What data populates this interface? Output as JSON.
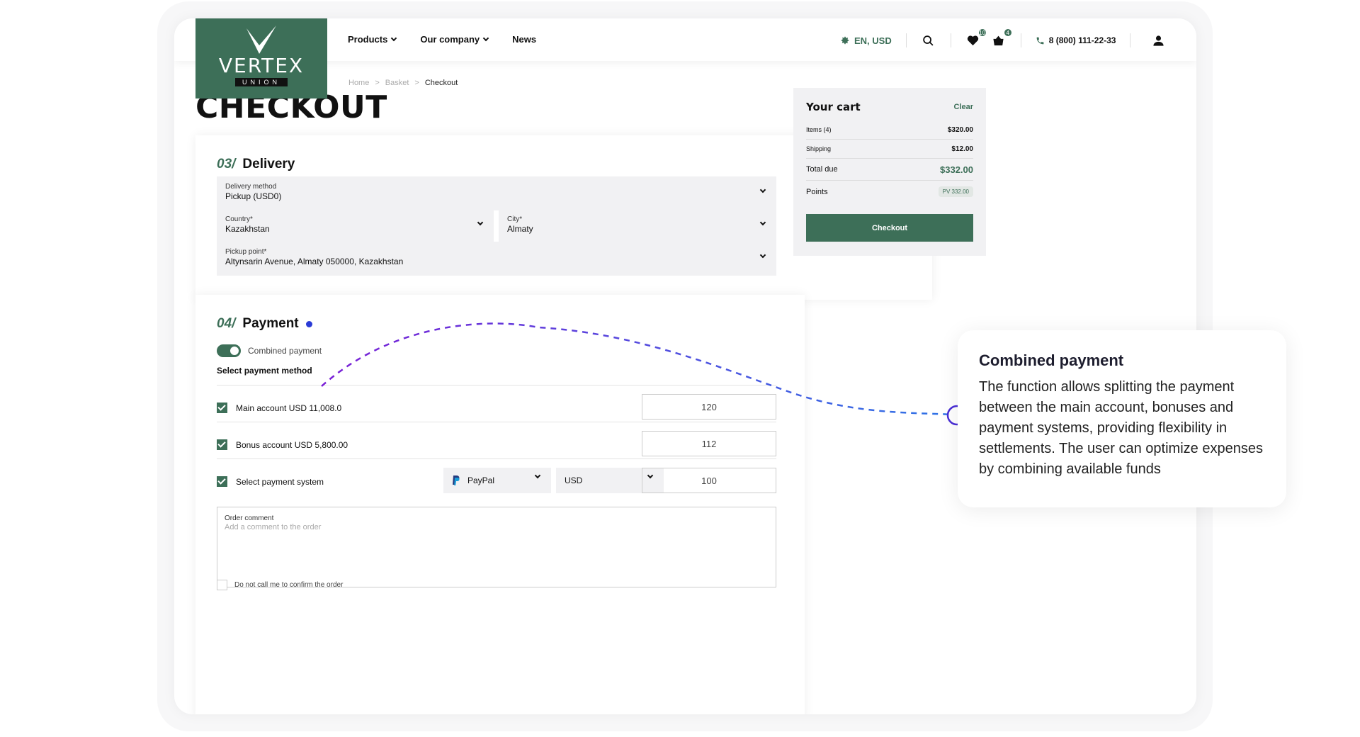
{
  "brand": {
    "logo_word": "VERTEX",
    "logo_sub": "UNION",
    "accent": "#3d6f58"
  },
  "nav": {
    "items": [
      {
        "label": "Products",
        "has_dropdown": true
      },
      {
        "label": "Our company",
        "has_dropdown": true
      },
      {
        "label": "News",
        "has_dropdown": false
      }
    ]
  },
  "header": {
    "locale": "EN, USD",
    "wishlist_count": "10",
    "cart_count": "4",
    "phone": "8 (800) 111-22-33"
  },
  "breadcrumb": {
    "items": [
      "Home",
      "Basket",
      "Checkout"
    ]
  },
  "page": {
    "title": "CHECKOUT"
  },
  "delivery": {
    "num": "03/",
    "title": "Delivery",
    "method": {
      "label": "Delivery method",
      "value": "Pickup (USD0)"
    },
    "country": {
      "label": "Country*",
      "value": "Kazakhstan"
    },
    "city": {
      "label": "City*",
      "value": "Almaty"
    },
    "pickup": {
      "label": "Pickup point*",
      "value": "Altynsarin Avenue, Almaty 050000, Kazakhstan"
    }
  },
  "payment": {
    "num": "04/",
    "title": "Payment",
    "combined_label": "Combined payment",
    "select_title": "Select payment method",
    "rows": [
      {
        "label": "Main account USD 11,008.0",
        "amount": "120"
      },
      {
        "label": "Bonus account USD 5,800.00",
        "amount": "112"
      },
      {
        "label": "Select payment system",
        "amount": "100",
        "system": "PayPal",
        "currency": "USD"
      }
    ],
    "comment": {
      "label": "Order comment",
      "placeholder": "Add a comment to the order"
    },
    "no_call": "Do not call me to confirm the order"
  },
  "cart": {
    "title": "Your cart",
    "clear": "Clear",
    "items_label": "Items (4)",
    "items_value": "$320.00",
    "shipping_label": "Shipping",
    "shipping_value": "$12.00",
    "total_label": "Total due",
    "total_value": "$332.00",
    "points_label": "Points",
    "points_value": "PV 332.00",
    "checkout": "Checkout"
  },
  "callout": {
    "title": "Combined payment",
    "body": "The function allows splitting the payment between the main account, bonuses and payment systems, providing flexibility in settlements. The user can optimize expenses by combining available funds"
  }
}
